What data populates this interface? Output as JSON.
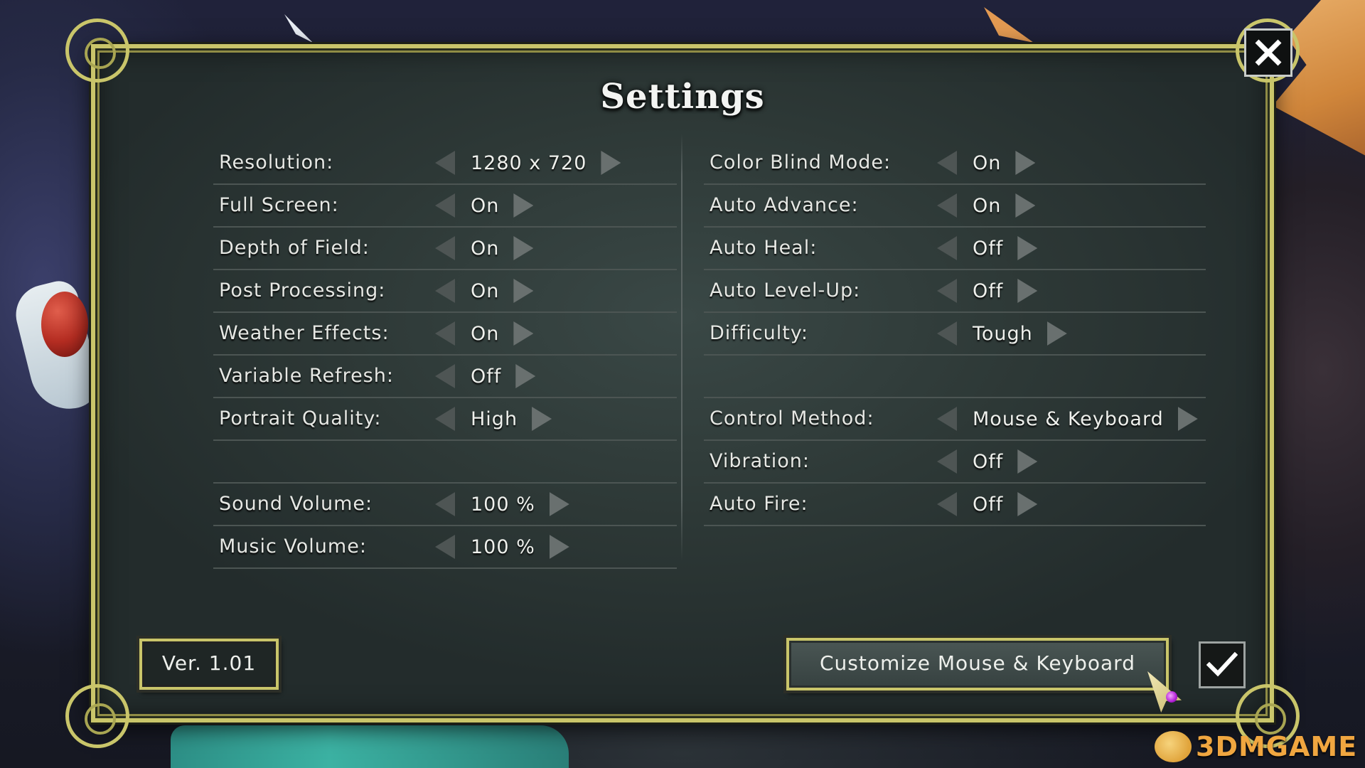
{
  "title": "Settings",
  "left_settings": [
    {
      "label": "Resolution:",
      "value": "1280 x 720"
    },
    {
      "label": "Full Screen:",
      "value": "On"
    },
    {
      "label": "Depth of Field:",
      "value": "On"
    },
    {
      "label": "Post Processing:",
      "value": "On"
    },
    {
      "label": "Weather Effects:",
      "value": "On"
    },
    {
      "label": "Variable Refresh:",
      "value": "Off"
    },
    {
      "label": "Portrait Quality:",
      "value": "High"
    },
    {
      "label": "",
      "value": ""
    },
    {
      "label": "Sound Volume:",
      "value": "100 %"
    },
    {
      "label": "Music Volume:",
      "value": "100 %"
    }
  ],
  "right_settings": [
    {
      "label": "Color Blind Mode:",
      "value": "On"
    },
    {
      "label": "Auto Advance:",
      "value": "On"
    },
    {
      "label": "Auto Heal:",
      "value": "Off"
    },
    {
      "label": "Auto Level-Up:",
      "value": "Off"
    },
    {
      "label": "Difficulty:",
      "value": "Tough"
    },
    {
      "label": "",
      "value": ""
    },
    {
      "label": "Control Method:",
      "value": "Mouse & Keyboard"
    },
    {
      "label": "Vibration:",
      "value": "Off"
    },
    {
      "label": "Auto Fire:",
      "value": "Off"
    }
  ],
  "version": "Ver. 1.01",
  "customize_button": "Customize Mouse & Keyboard",
  "icons": {
    "close": "close-icon",
    "confirm": "checkmark-icon",
    "arrow_left": "arrow-left-icon",
    "arrow_right": "arrow-right-icon"
  },
  "colors": {
    "frame_gold": "#c9c56a",
    "panel_bg": "#2d3836",
    "text": "#eef0ec"
  },
  "watermark": "3DMGAME"
}
